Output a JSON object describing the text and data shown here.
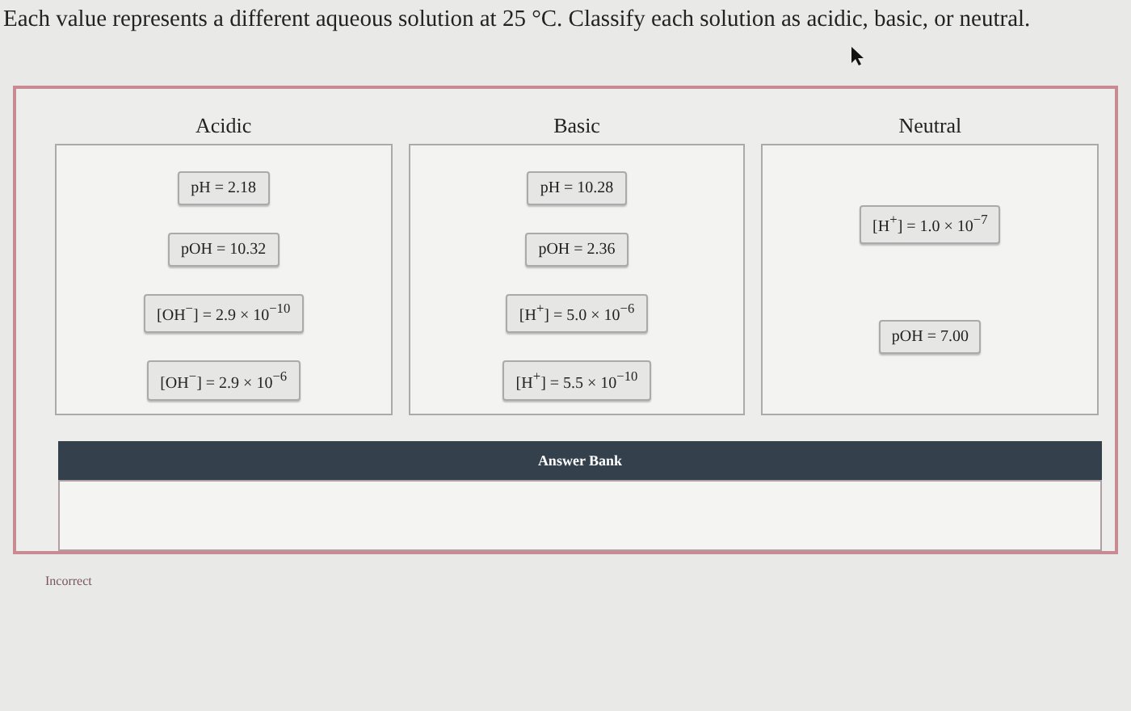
{
  "question": "Each value represents a different aqueous solution at 25 °C. Classify each solution as acidic, basic, or neutral.",
  "bins": [
    {
      "label": "Acidic",
      "items": [
        "pH = 2.18",
        "pOH = 10.32",
        "[OH$^{−}$] = 2.9 × 10$^{−10}$",
        "[OH$^{−}$] = 2.9 × 10$^{−6}$"
      ]
    },
    {
      "label": "Basic",
      "items": [
        "pH = 10.28",
        "pOH = 2.36",
        "[H$^{+}$] = 5.0 × 10$^{−6}$",
        "[H$^{+}$] = 5.5 × 10$^{−10}$"
      ]
    },
    {
      "label": "Neutral",
      "items": [
        "[H$^{+}$] = 1.0 × 10$^{−7}$",
        "pOH = 7.00"
      ]
    }
  ],
  "answer_bank": {
    "title": "Answer Bank"
  },
  "feedback": "Incorrect"
}
